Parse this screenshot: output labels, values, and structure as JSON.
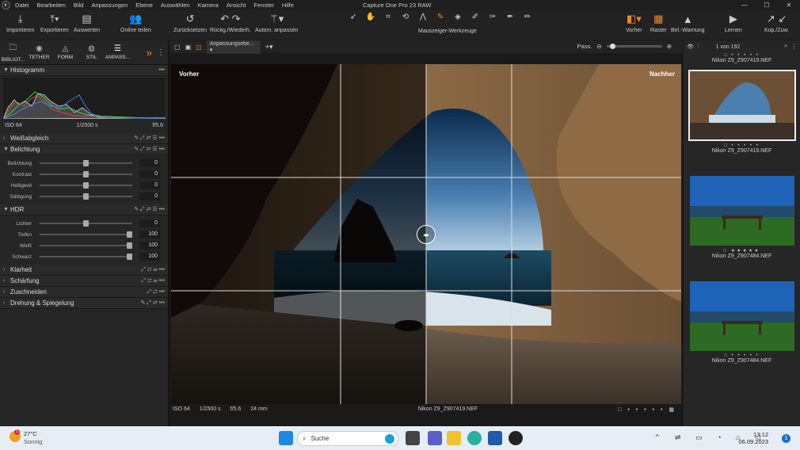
{
  "menubar": {
    "items": [
      "Datei",
      "Bearbeiten",
      "Bild",
      "Anpassungen",
      "Ebene",
      "Auswählen",
      "Kamera",
      "Ansicht",
      "Fenster",
      "Hilfe"
    ],
    "title": "Capture One Pro 23 RAW"
  },
  "toolbar": {
    "import": "Importieren",
    "export": "Exportieren",
    "evaluate": "Auswerten",
    "share": "Online teilen",
    "reset": "Zurücksetzen",
    "undo": "Rückg./Wiederh.",
    "auto": "Autom. anpassen",
    "cursor_tools": "Mauszeiger-Werkzeuge",
    "before": "Vorher",
    "grid": "Raster",
    "exposure_warning": "Bel.-Warnung",
    "learn": "Lernen",
    "copy": "Kop./Zuw."
  },
  "tabs": [
    "BIBLIOT...",
    "TETHER",
    "FORM",
    "STIL",
    "ANPASS..."
  ],
  "histogram": {
    "title": "Histogramm",
    "iso": "ISO 64",
    "shutter": "1/2500 s",
    "aperture": "f/5.6"
  },
  "sections": {
    "white_balance": "Weißabgleich",
    "exposure": "Belichtung",
    "hdr": "HDR",
    "clarity": "Klarheit",
    "sharpening": "Schärfung",
    "crop": "Zuschneiden",
    "rotation": "Drehung & Spiegelung"
  },
  "exposure_sliders": [
    {
      "label": "Belichtung",
      "value": "0",
      "pos": 0.5
    },
    {
      "label": "Kontrast",
      "value": "0",
      "pos": 0.5
    },
    {
      "label": "Helligkeit",
      "value": "0",
      "pos": 0.5
    },
    {
      "label": "Sättigung",
      "value": "0",
      "pos": 0.5
    }
  ],
  "hdr_sliders": [
    {
      "label": "Lichter",
      "value": "0",
      "pos": 0.5
    },
    {
      "label": "Tiefen",
      "value": "100",
      "pos": 1.0
    },
    {
      "label": "Weiß",
      "value": "100",
      "pos": 1.0
    },
    {
      "label": "Schwarz",
      "value": "100",
      "pos": 1.0
    }
  ],
  "viewer": {
    "layer_dropdown": "Anpassungsebe...",
    "pass_label": "Pass.",
    "before_label": "Vorher",
    "after_label": "Nachher",
    "status": {
      "iso": "ISO 64",
      "shutter": "1/2500 s",
      "aperture": "f/5.6",
      "focal": "24 mm",
      "filename": "Nikon Z9_Z907419.NEF"
    }
  },
  "browser": {
    "count": "1 von 192",
    "thumbs": [
      {
        "name": "Nikon Z9_Z907419.NEF",
        "stars": "□ • • • • •"
      },
      {
        "name": "Nikon Z9_Z907419.NEF",
        "stars": "□ • • • • •"
      },
      {
        "name": "Nikon Z9_Z907484.NEF",
        "stars": "□ ★★★★★"
      },
      {
        "name": "Nikon Z9_Z907484.NEF",
        "stars": "□ • • • • •"
      }
    ]
  },
  "taskbar": {
    "weather_temp": "27°C",
    "weather_desc": "Sonnig",
    "search": "Suche",
    "time": "13:12",
    "date": "06.09.2023",
    "notif": "1"
  },
  "colors": {
    "accent": "#f08a24"
  }
}
